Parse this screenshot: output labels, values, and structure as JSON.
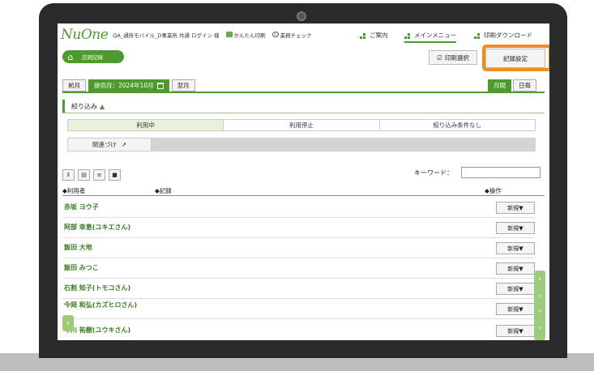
{
  "app": {
    "logo": "NuOne",
    "user_line": "QA_通所モバイル_D事業所 共通 ログイン 様",
    "links": [
      "かんたん印刷",
      "業務チェック"
    ]
  },
  "nav_tabs": [
    {
      "label": "ご案内",
      "active": false
    },
    {
      "label": "メインメニュー",
      "active": true
    },
    {
      "label": "印刷ダウンロード",
      "active": false
    }
  ],
  "breadcrumb": {
    "label": "訪問記録"
  },
  "toolbar": {
    "print_select": "印刷選択",
    "record_settings": "記録設定"
  },
  "month": {
    "prev": "前月",
    "current": "提供月：2024年10月",
    "next": "翌月"
  },
  "view": {
    "monthly": "月間",
    "daily": "日毎"
  },
  "filter": {
    "title": "絞り込み",
    "statuses": [
      "利用中",
      "利用停止",
      "絞り込み条件なし"
    ],
    "link_label": "関連づけ"
  },
  "search": {
    "keyword_label": "キーワード："
  },
  "table": {
    "col_user": "◆利用者",
    "col_record": "◆記録",
    "col_action": "◆操作",
    "rows": [
      {
        "name": "赤坂 ヨウ子",
        "action": "新規▼"
      },
      {
        "name": "阿部 幸恵(ユキエさん)",
        "action": "新規▼"
      },
      {
        "name": "飯田 大地",
        "action": "新規▼"
      },
      {
        "name": "飯田 みつこ",
        "action": "新規▼"
      },
      {
        "name": "石割 知子(トモコさん)",
        "action": "新規▼"
      },
      {
        "name": "今岡 和弘(カズヒロさん)",
        "action": "新規▼"
      },
      {
        "name": "今川 祐樹(ユウキさん)",
        "action": "新規▼"
      }
    ]
  },
  "colors": {
    "brand": "#4d9a2e",
    "highlight": "#ef8d22"
  }
}
